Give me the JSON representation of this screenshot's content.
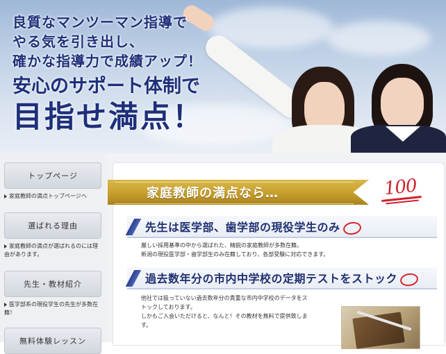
{
  "hero": {
    "lead_lines": [
      "良質なマンツーマン指導で",
      "やる気を引き出し、",
      "確かな指導力で成績アップ！"
    ],
    "sub": "安心のサポート体制で",
    "big": "目指せ満点！"
  },
  "sidebar": {
    "items": [
      {
        "label": "トップページ",
        "desc": "家庭教師の満点トップページへ"
      },
      {
        "label": "選ばれる理由",
        "desc": "家庭教師の満点が選ばれるのには理由があります。"
      },
      {
        "label": "先生・教材紹介",
        "desc": "医学部系の現役学生の先生が多数在籍！"
      },
      {
        "label": "無料体験レッスン",
        "desc": ""
      }
    ]
  },
  "main": {
    "banner": "家庭教師の満点なら…",
    "hundred": "100",
    "sections": [
      {
        "title": "先生は医学部、歯学部の現役学生のみ",
        "lines": [
          "厳しい採用基準の中から選ばれた、精鋭の家庭教師が多数在籍。",
          "新潟の現役医学部・歯学部生のみ在籍しており、各部受験に対応できます。"
        ]
      },
      {
        "title": "過去数年分の市内中学校の定期テストをストック",
        "lines": [
          "他社では扱っていない過去数年分の貴重な市内中学校のデータをス",
          "トックしております。",
          "しかもご入会いただけると、なんと！その教材を無料で提供致しま",
          "す。"
        ]
      }
    ]
  }
}
